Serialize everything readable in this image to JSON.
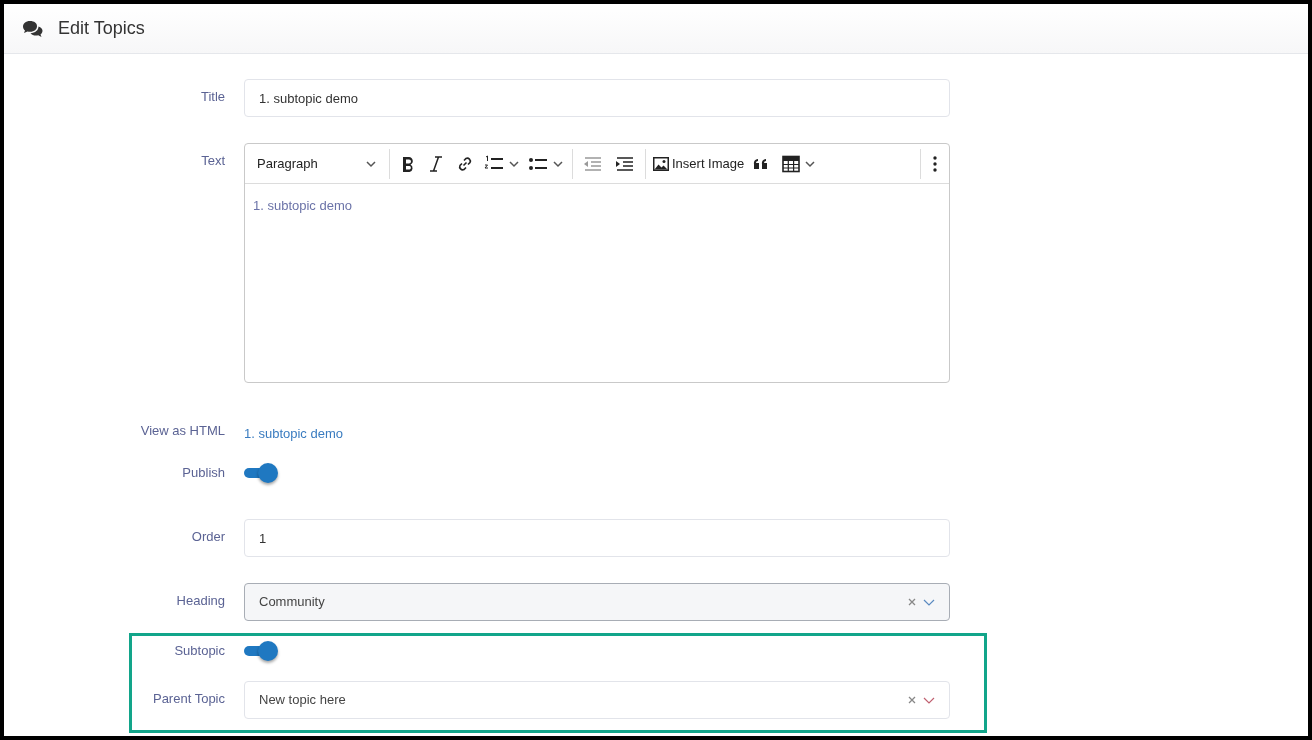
{
  "window": {
    "title": "Edit Topics"
  },
  "fields": [
    {
      "kind": "text",
      "label": "Title",
      "value": "1. subtopic demo",
      "highlighted": false
    },
    {
      "kind": "editor",
      "label": "Text",
      "value": "1. subtopic demo",
      "highlighted": false,
      "toolbar": {
        "block_style": "Paragraph",
        "insert_image": "Insert Image"
      }
    },
    {
      "kind": "html",
      "label": "View as HTML",
      "value": "1. subtopic demo",
      "highlighted": false
    },
    {
      "kind": "toggle",
      "label": "Publish",
      "on": true,
      "highlighted": false
    },
    {
      "kind": "text",
      "label": "Order",
      "value": "1",
      "highlighted": false
    },
    {
      "kind": "select",
      "label": "Heading",
      "value": "Community",
      "disabled": true,
      "highlighted": false
    },
    {
      "kind": "toggle",
      "label": "Subtopic",
      "on": true,
      "highlighted": true
    },
    {
      "kind": "select",
      "label": "Parent Topic",
      "value": "New topic here",
      "disabled": false,
      "highlighted": true
    }
  ]
}
